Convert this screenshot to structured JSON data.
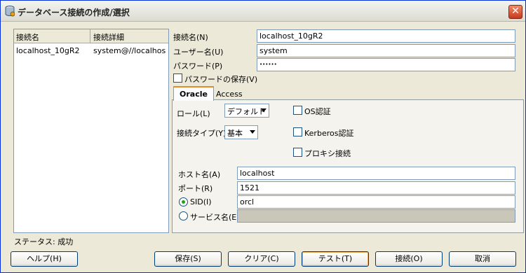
{
  "window": {
    "title": "データベース接続の作成/選択",
    "close_label": "✕"
  },
  "connections": {
    "headers": [
      "接続名",
      "接続詳細"
    ],
    "rows": [
      {
        "name": "localhost_10gR2",
        "detail": "system@//localhos..."
      }
    ]
  },
  "status": "ステータス: 成功",
  "form": {
    "conn_name_label": "接続名(N)",
    "conn_name_value": "localhost_10gR2",
    "user_label": "ユーザー名(U)",
    "user_value": "system",
    "password_label": "パスワード(P)",
    "password_value": "••••••",
    "save_password_label": "パスワードの保存(V)"
  },
  "tabs": {
    "oracle": "Oracle",
    "access": "Access"
  },
  "oracle": {
    "role_label": "ロール(L)",
    "role_value": "デフォルト",
    "conn_type_label": "接続タイプ(Y)",
    "conn_type_value": "基本",
    "os_auth_label": "OS認証",
    "kerberos_label": "Kerberos認証",
    "proxy_label": "プロキシ接続",
    "host_label": "ホスト名(A)",
    "host_value": "localhost",
    "port_label": "ポート(R)",
    "port_value": "1521",
    "sid_label": "SID(I)",
    "sid_value": "orcl",
    "service_label": "サービス名(E)",
    "service_value": ""
  },
  "buttons": {
    "help": "ヘルプ(H)",
    "save": "保存(S)",
    "clear": "クリア(C)",
    "test": "テスト(T)",
    "connect": "接続(O)",
    "cancel": "取消"
  }
}
